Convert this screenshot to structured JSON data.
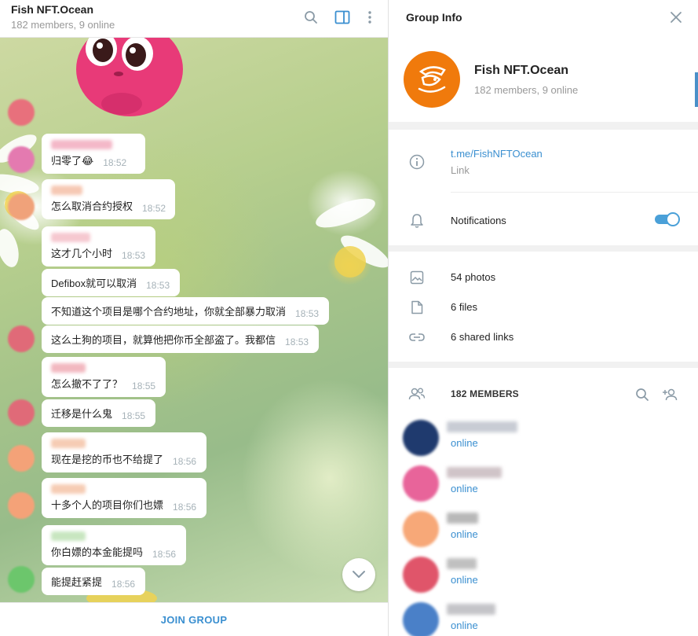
{
  "chat": {
    "title": "Fish NFT.Ocean",
    "subtitle": "182 members, 9 online",
    "join_label": "JOIN GROUP",
    "messages": [
      {
        "text": "归零了😂",
        "time": "18:52"
      },
      {
        "text": "怎么取消合约授权",
        "time": "18:52"
      },
      {
        "text": "这才几个小时",
        "time": "18:53"
      },
      {
        "text": "Defibox就可以取消",
        "time": "18:53"
      },
      {
        "text": "不知道这个项目是哪个合约地址，你就全部暴力取消",
        "time": "18:53"
      },
      {
        "text": "这么土狗的项目，就算他把你币全部盗了。我都信",
        "time": "18:53"
      },
      {
        "text": "怎么撤不了了？",
        "time": "18:55"
      },
      {
        "text": "迁移是什么鬼",
        "time": "18:55"
      },
      {
        "text": "现在是挖的币也不给提了",
        "time": "18:56"
      },
      {
        "text": "十多个人的项目你们也嫖",
        "time": "18:56"
      },
      {
        "text": "你白嫖的本金能提吗",
        "time": "18:56"
      },
      {
        "text": "能提赶紧提",
        "time": "18:56"
      }
    ]
  },
  "info": {
    "title": "Group Info",
    "group_name": "Fish NFT.Ocean",
    "group_members": "182 members, 9 online",
    "link_url": "t.me/FishNFTOcean",
    "link_label": "Link",
    "notifications_label": "Notifications",
    "notifications_on": true,
    "photos": "54 photos",
    "files": "6 files",
    "shared_links": "6 shared links",
    "members_title": "182 MEMBERS",
    "members": [
      {
        "status": "online",
        "color": "#1f3a6e"
      },
      {
        "status": "online",
        "color": "#e8649a"
      },
      {
        "status": "online",
        "color": "#f7a878"
      },
      {
        "status": "online",
        "color": "#e0556a"
      },
      {
        "status": "online",
        "color": "#4a80c8"
      }
    ]
  },
  "colors": {
    "accent": "#3a8fd0",
    "toggle": "#4aa0d8",
    "group_avatar": "#f07a0c",
    "sticker": "#e83a78"
  }
}
